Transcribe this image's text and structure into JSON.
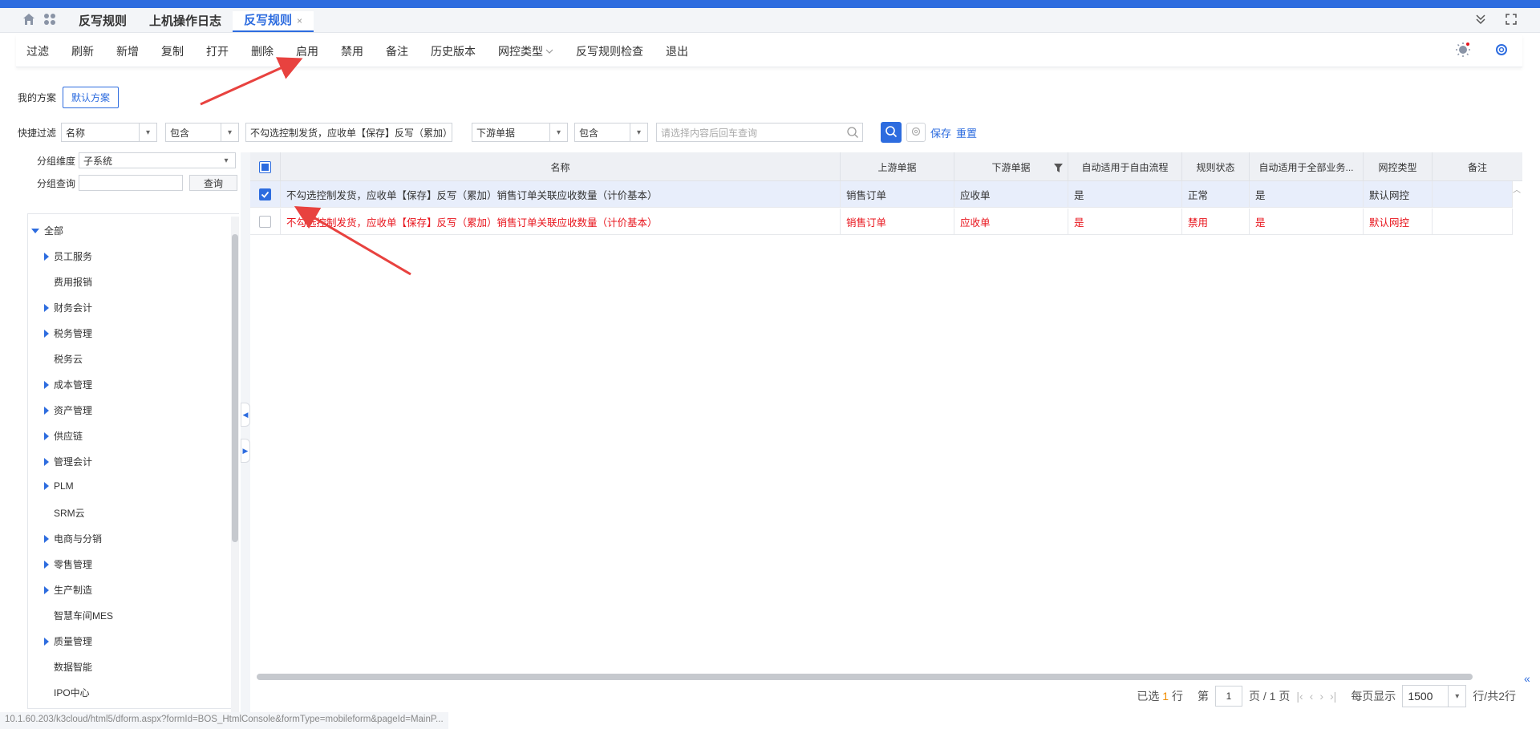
{
  "tabbar": {
    "tabs": [
      {
        "label": "反写规则",
        "active": false
      },
      {
        "label": "上机操作日志",
        "active": false
      },
      {
        "label": "反写规则",
        "active": true,
        "closable": true
      }
    ],
    "close_glyph": "×"
  },
  "toolbar": {
    "items": [
      "过滤",
      "刷新",
      "新增",
      "复制",
      "打开",
      "删除",
      "启用",
      "禁用",
      "备注",
      "历史版本",
      "网控类型",
      "反写规则检查",
      "退出"
    ]
  },
  "scheme": {
    "label": "我的方案",
    "default_button": "默认方案"
  },
  "quick_filter": {
    "label": "快捷过滤",
    "field1": "名称",
    "op1": "包含",
    "value1": "不勾选控制发货，应收单【保存】反写（累加）",
    "field2": "下游单据",
    "op2": "包含",
    "search_placeholder": "请选择内容后回车查询",
    "save_label": "保存",
    "reset_label": "重置"
  },
  "left_panel": {
    "group_dim_label": "分组维度",
    "group_dim_value": "子系统",
    "group_query_label": "分组查询",
    "query_button": "查询",
    "tree": [
      {
        "label": "全部",
        "level": 0,
        "expanded": true
      },
      {
        "label": "员工服务",
        "level": 1,
        "has_children": true
      },
      {
        "label": "费用报销",
        "level": 1,
        "has_children": false
      },
      {
        "label": "财务会计",
        "level": 1,
        "has_children": true
      },
      {
        "label": "税务管理",
        "level": 1,
        "has_children": true
      },
      {
        "label": "税务云",
        "level": 1,
        "has_children": false
      },
      {
        "label": "成本管理",
        "level": 1,
        "has_children": true
      },
      {
        "label": "资产管理",
        "level": 1,
        "has_children": true
      },
      {
        "label": "供应链",
        "level": 1,
        "has_children": true
      },
      {
        "label": "管理会计",
        "level": 1,
        "has_children": true
      },
      {
        "label": "PLM",
        "level": 1,
        "has_children": true
      },
      {
        "label": "SRM云",
        "level": 1,
        "has_children": false
      },
      {
        "label": "电商与分销",
        "level": 1,
        "has_children": true
      },
      {
        "label": "零售管理",
        "level": 1,
        "has_children": true
      },
      {
        "label": "生产制造",
        "level": 1,
        "has_children": true
      },
      {
        "label": "智慧车间MES",
        "level": 1,
        "has_children": false
      },
      {
        "label": "质量管理",
        "level": 1,
        "has_children": true
      },
      {
        "label": "数据智能",
        "level": 1,
        "has_children": false
      },
      {
        "label": "IPO中心",
        "level": 1,
        "has_children": false
      }
    ]
  },
  "grid": {
    "columns": [
      "名称",
      "上游单据",
      "下游单据",
      "自动适用于自由流程",
      "规则状态",
      "自动适用于全部业务...",
      "网控类型",
      "备注"
    ],
    "rows": [
      {
        "checked": true,
        "red": false,
        "cells": [
          "不勾选控制发货，应收单【保存】反写（累加）销售订单关联应收数量（计价基本）",
          "销售订单",
          "应收单",
          "是",
          "正常",
          "是",
          "默认网控",
          ""
        ]
      },
      {
        "checked": false,
        "red": true,
        "cells": [
          "不勾选控制发货，应收单【保存】反写（累加）销售订单关联应收数量（计价基本）",
          "销售订单",
          "应收单",
          "是",
          "禁用",
          "是",
          "默认网控",
          ""
        ]
      }
    ]
  },
  "pager": {
    "selected_prefix": "已选",
    "selected_count": "1",
    "selected_suffix": "行",
    "page_prefix": "第",
    "page_value": "1",
    "page_suffix": "页 / 1 页",
    "per_page_label": "每页显示",
    "per_page_value": "1500",
    "total_text": "行/共2行"
  },
  "status_url": "10.1.60.203/k3cloud/html5/dform.aspx?formId=BOS_HtmlConsole&formType=mobileform&pageId=MainP...",
  "colors": {
    "accent": "#2d6cdf",
    "disabled_row": "#e8141c",
    "annotation_arrow": "#e8423f"
  }
}
